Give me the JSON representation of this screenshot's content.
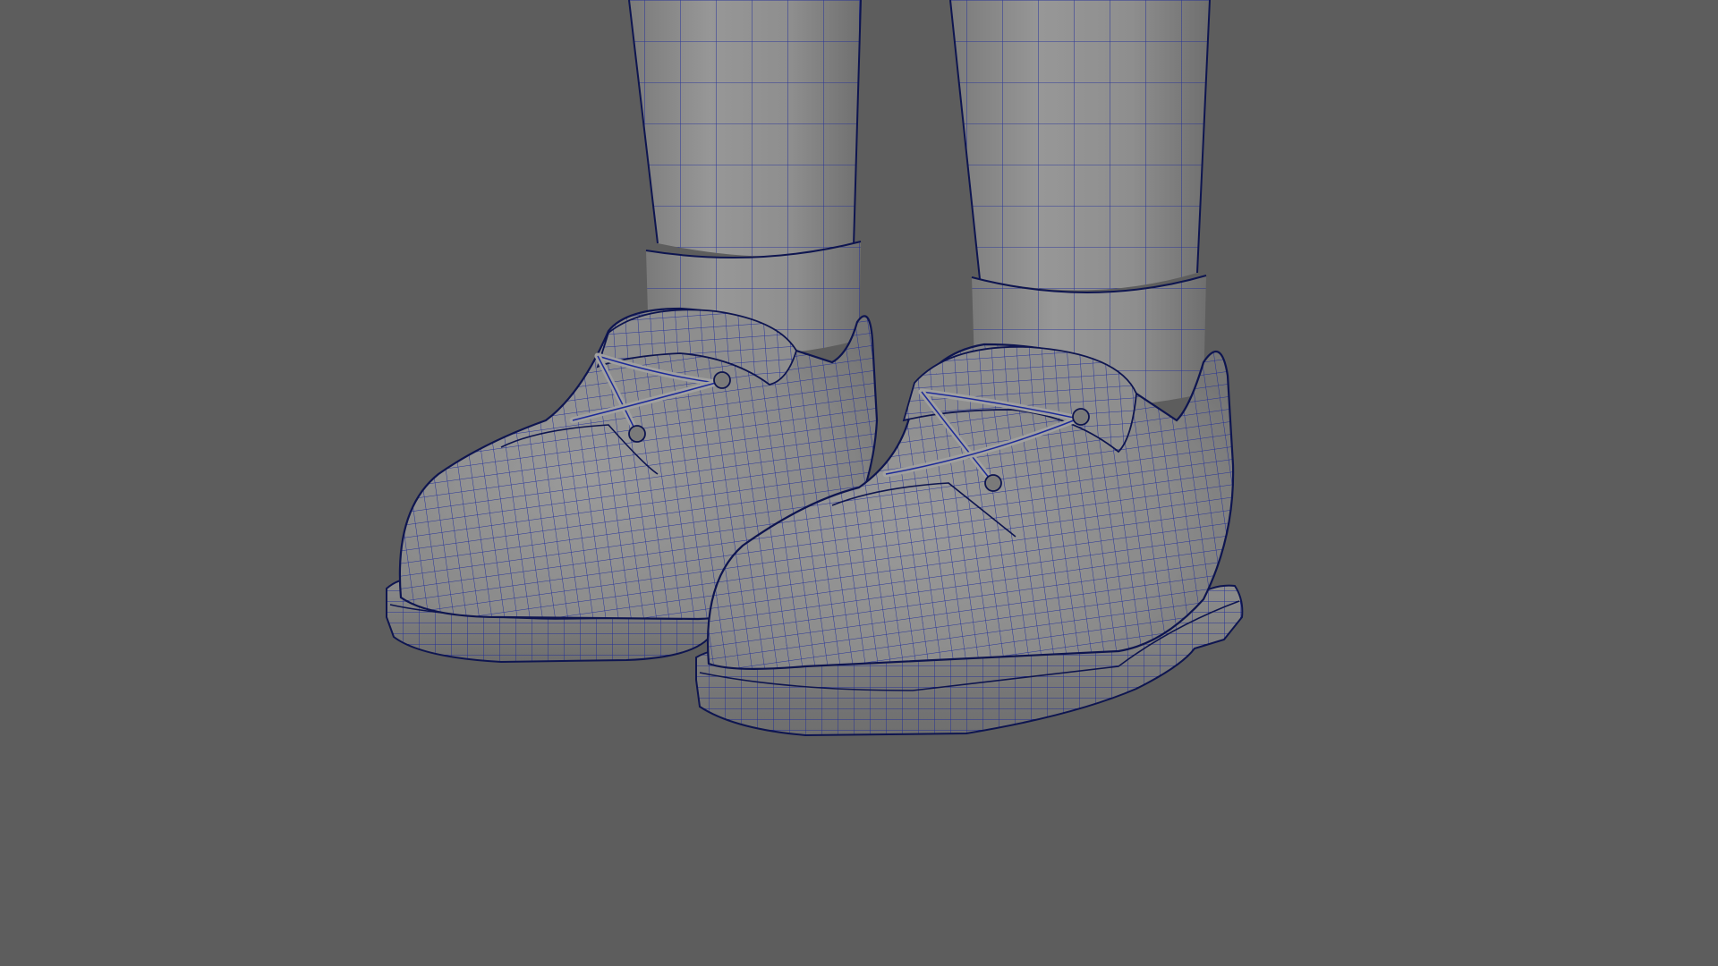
{
  "viewport": {
    "background_color": "#5d5d5d",
    "shaded_surface_color": "#8a8a8a",
    "wireframe_color": "#1d2a9a",
    "outline_color": "#0e1550"
  },
  "scene": {
    "objects": [
      "left-leg-mesh",
      "right-leg-mesh",
      "left-sock-cuff-mesh",
      "right-sock-cuff-mesh",
      "left-shoe-mesh",
      "right-shoe-mesh",
      "left-shoe-sole-mesh",
      "right-shoe-sole-mesh",
      "left-shoelace-mesh",
      "right-shoelace-mesh"
    ]
  }
}
